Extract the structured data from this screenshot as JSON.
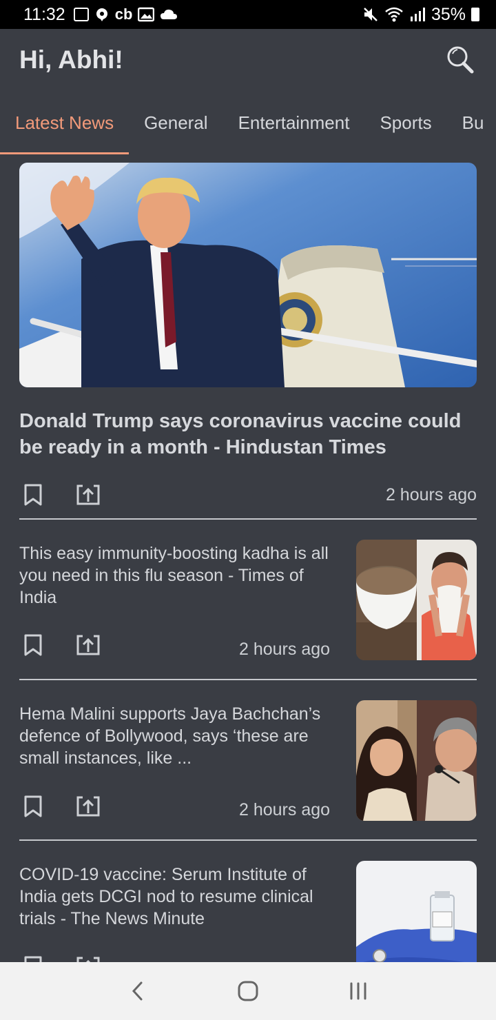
{
  "status": {
    "time": "11:32",
    "battery": "35%"
  },
  "header": {
    "greeting": "Hi, Abhi!"
  },
  "tabs": [
    {
      "label": "Latest News",
      "active": true
    },
    {
      "label": "General"
    },
    {
      "label": "Entertainment"
    },
    {
      "label": "Sports"
    },
    {
      "label": "Bu"
    }
  ],
  "articles": [
    {
      "title": "Donald Trump says coronavirus vaccine could be ready in a month - Hindustan Times",
      "time": "2 hours ago"
    },
    {
      "title": "This easy immunity-boosting kadha is all you need in this flu season - Times of India",
      "time": "2 hours ago"
    },
    {
      "title": "Hema Malini supports Jaya Bachchan’s defence of Bollywood, says ‘these are small instances, like ...",
      "time": "2 hours ago"
    },
    {
      "title": "COVID-19 vaccine: Serum Institute of India gets DCGI nod to resume clinical trials - The News Minute",
      "time": ""
    }
  ],
  "colors": {
    "background": "#3a3d44",
    "accent": "#f29a7a",
    "navbar": "#f2f2f2"
  },
  "icons": [
    "search-icon",
    "bookmark-icon",
    "share-icon",
    "back-icon",
    "home-icon",
    "recents-icon"
  ]
}
